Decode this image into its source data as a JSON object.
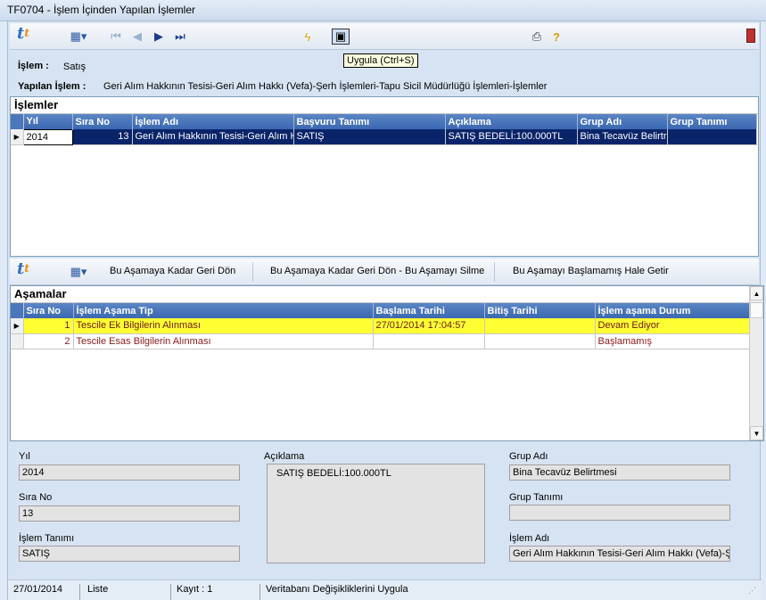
{
  "window": {
    "title": "TF0704 - İşlem İçinden Yapılan İşlemler"
  },
  "toolbar": {
    "tooltip": "Uygula (Ctrl+S)"
  },
  "info": {
    "islem_label": "İşlem :",
    "islem_value": "Satış",
    "yapilan_label": "Yapılan İşlem :",
    "yapilan_value": "Geri Alım Hakkının Tesisi-Geri Alım Hakkı (Vefa)-Şerh İşlemleri-Tapu Sicil Müdürlüğü İşlemleri-İşlemler"
  },
  "islemler": {
    "title": "İşlemler",
    "columns": [
      "Yıl",
      "Sıra No",
      "İşlem Adı",
      "Başvuru Tanımı",
      "Açıklama",
      "Grup Adı",
      "Grup Tanımı"
    ],
    "rows": [
      [
        "2014",
        "13",
        "Geri Alım Hakkının Tesisi-Geri Alım Ha",
        "SATIŞ",
        "SATIŞ BEDELİ:100.000TL",
        "Bina Tecavüz Belirtr",
        ""
      ]
    ]
  },
  "asama_toolbar": {
    "btn1": "Bu Aşamaya Kadar Geri Dön",
    "btn2": "Bu Aşamaya Kadar Geri Dön - Bu Aşamayı Silme",
    "btn3": "Bu Aşamayı Başlamamış Hale Getir"
  },
  "asamalar": {
    "title": "Aşamalar",
    "columns": [
      "Sıra No",
      "İşlem Aşama Tip",
      "Başlama Tarihi",
      "Bitiş Tarihi",
      "İşlem aşama Durum"
    ],
    "rows": [
      [
        "1",
        "Tescile Ek Bilgilerin Alınması",
        "27/01/2014 17:04:57",
        "",
        "Devam Ediyor"
      ],
      [
        "2",
        "Tescile Esas Bilgilerin Alınması",
        "",
        "",
        "Başlamamış"
      ]
    ]
  },
  "details": {
    "yil_label": "Yıl",
    "yil_value": "2014",
    "sirano_label": "Sıra No",
    "sirano_value": "13",
    "islemtanimi_label": "İşlem Tanımı",
    "islemtanimi_value": "SATIŞ",
    "aciklama_label": "Açıklama",
    "aciklama_value": "SATIŞ BEDELİ:100.000TL",
    "grupadi_label": "Grup Adı",
    "grupadi_value": "Bina Tecavüz Belirtmesi",
    "gruptanimi_label": "Grup Tanımı",
    "gruptanimi_value": "",
    "islemadi_label": "İşlem Adı",
    "islemadi_value": "Geri Alım Hakkının Tesisi-Geri Alım Hakkı (Vefa)-Şer"
  },
  "status": {
    "date": "27/01/2014",
    "mode": "Liste",
    "kayit": "Kayıt : 1",
    "message": "Veritabanı Değişikliklerini Uygula"
  }
}
